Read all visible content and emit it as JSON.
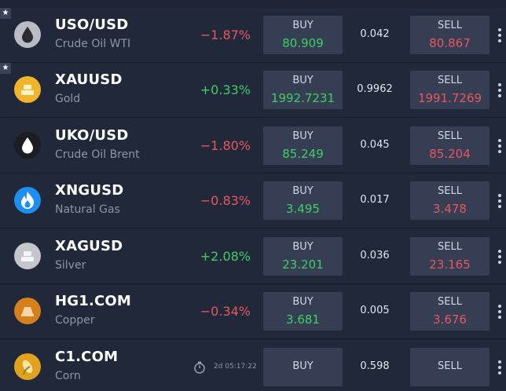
{
  "colors": {
    "background": "#212839",
    "button": "#363e54",
    "positive": "#3fcf63",
    "negative": "#e8575e"
  },
  "instruments": [
    {
      "symbol": "USO/USD",
      "name": "Crude Oil WTI",
      "change": "−1.87%",
      "direction": "negative",
      "buy_label": "BUY",
      "buy_price": "80.909",
      "spread": "0.042",
      "sell_label": "SELL",
      "sell_price": "80.867",
      "favorite": true,
      "icon": "oil-drop-icon",
      "icon_color": "#b9bcc4"
    },
    {
      "symbol": "XAUUSD",
      "name": "Gold",
      "change": "+0.33%",
      "direction": "positive",
      "buy_label": "BUY",
      "buy_price": "1992.7231",
      "spread": "0.9962",
      "sell_label": "SELL",
      "sell_price": "1991.7269",
      "favorite": true,
      "icon": "gold-bars-icon",
      "icon_color": "#f2b42a"
    },
    {
      "symbol": "UKO/USD",
      "name": "Crude Oil Brent",
      "change": "−1.80%",
      "direction": "negative",
      "buy_label": "BUY",
      "buy_price": "85.249",
      "spread": "0.045",
      "sell_label": "SELL",
      "sell_price": "85.204",
      "favorite": false,
      "icon": "oil-drop-icon",
      "icon_color": "#1b1d22"
    },
    {
      "symbol": "XNGUSD",
      "name": "Natural Gas",
      "change": "−0.83%",
      "direction": "negative",
      "buy_label": "BUY",
      "buy_price": "3.495",
      "spread": "0.017",
      "sell_label": "SELL",
      "sell_price": "3.478",
      "favorite": false,
      "icon": "flame-icon",
      "icon_color": "#1d8ff0"
    },
    {
      "symbol": "XAGUSD",
      "name": "Silver",
      "change": "+2.08%",
      "direction": "positive",
      "buy_label": "BUY",
      "buy_price": "23.201",
      "spread": "0.036",
      "sell_label": "SELL",
      "sell_price": "23.165",
      "favorite": false,
      "icon": "silver-bars-icon",
      "icon_color": "#c4c6cc"
    },
    {
      "symbol": "HG1.COM",
      "name": "Copper",
      "change": "−0.34%",
      "direction": "negative",
      "buy_label": "BUY",
      "buy_price": "3.681",
      "spread": "0.005",
      "sell_label": "SELL",
      "sell_price": "3.676",
      "favorite": false,
      "icon": "copper-bar-icon",
      "icon_color": "#d6801c"
    },
    {
      "symbol": "C1.COM",
      "name": "Corn",
      "change": "",
      "direction": "neutral",
      "timer": "2d 05:17:22",
      "buy_label": "BUY",
      "buy_price": "",
      "spread": "0.598",
      "sell_label": "SELL",
      "sell_price": "",
      "favorite": false,
      "icon": "corn-icon",
      "icon_color": "#e3a21e"
    }
  ]
}
